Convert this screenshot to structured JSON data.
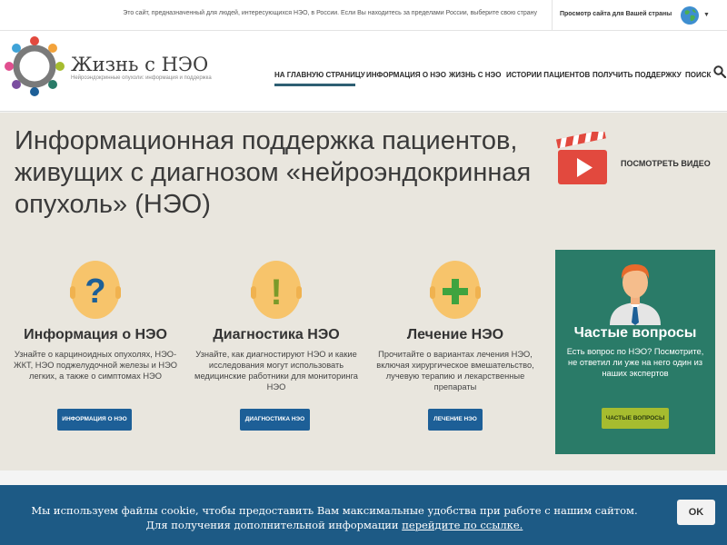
{
  "topbar": {
    "message": "Это сайт, предназначенный для людей, интересующихся НЭО, в России. Если Вы находитесь за пределами России, выберите свою страну",
    "country_label": "Просмотр сайта для Вашей страны",
    "caret": "▼"
  },
  "header": {
    "logo_title": "Жизнь с НЭО",
    "logo_subtitle": "Нейроэндокринные опухоли: информация и поддержка"
  },
  "nav": {
    "items": [
      "НА ГЛАВНУЮ СТРАНИЦУ",
      "ИНФОРМАЦИЯ О НЭО",
      "ЖИЗНЬ С НЭО",
      "ИСТОРИИ ПАЦИЕНТОВ",
      "ПОЛУЧИТЬ ПОДДЕРЖКУ",
      "ПОИСК"
    ],
    "active_index": 0
  },
  "hero": {
    "title": "Информационная поддержка пациентов, живущих с диагнозом «нейроэндокринная опухоль» (НЭО)",
    "video_label": "ПОСМОТРЕТЬ ВИДЕО"
  },
  "columns": [
    {
      "symbol": "?",
      "icon": "question-head-icon",
      "title": "Информация о НЭО",
      "text": "Узнайте о карциноидных опухолях, НЭО-ЖКТ, НЭО поджелудочной железы и НЭО легких, а также о симптомах НЭО",
      "button": "ИНФОРМАЦИЯ О НЭО"
    },
    {
      "symbol": "!",
      "icon": "exclamation-head-icon",
      "title": "Диагностика НЭО",
      "text": "Узнайте, как диагностируют НЭО и какие исследования могут использовать медицинские работники для мониторинга НЭО",
      "button": "ДИАГНОСТИКА НЭО"
    },
    {
      "symbol": "+",
      "icon": "plus-head-icon",
      "title": "Лечение НЭО",
      "text": "Прочитайте о вариантах лечения НЭО, включая хирургическое вмешательство, лучевую терапию и лекарственные препараты",
      "button": "ЛЕЧЕНИЕ НЭО"
    }
  ],
  "faq": {
    "title": "Частые вопросы",
    "text": "Есть вопрос по НЭО? Посмотрите, не ответил ли уже на него один из наших экспертов",
    "button": "ЧАСТЫЕ ВОПРОСЫ"
  },
  "cookie": {
    "line1": "Мы используем файлы cookie, чтобы предоставить Вам максимальные удобства при работе с нашим сайтом.",
    "line2_prefix": "Для получения дополнительной информации ",
    "line2_link": "перейдите по ссылке.",
    "ok": "OK"
  },
  "colors": {
    "nav_active_underline": "#2e5f73",
    "hero_bg": "#e9e6de",
    "head_icon": "#f7c46b",
    "question_mark": "#1d5f97",
    "exclamation_mark": "#7a9a2a",
    "plus_mark": "#3fa33f",
    "primary_button": "#1d5f97",
    "faq_panel": "#2a7b68",
    "faq_button": "#a6bc2f",
    "video_icon": "#e2493e",
    "cookie_bar": "#1d5a85"
  }
}
